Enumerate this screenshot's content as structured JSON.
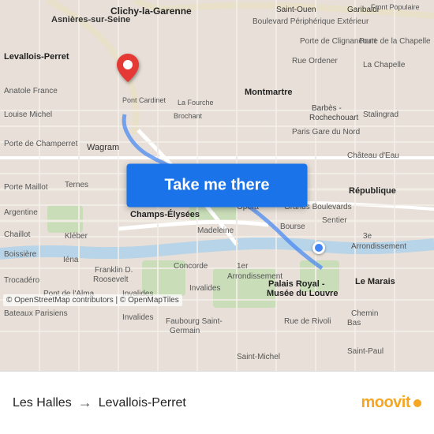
{
  "map": {
    "attribution": "© OpenStreetMap contributors | © OpenMapTiles"
  },
  "button": {
    "label": "Take me there"
  },
  "route": {
    "origin": "Les Halles",
    "destination": "Levallois-Perret",
    "arrow": "→"
  },
  "branding": {
    "name": "moovit"
  },
  "labels": {
    "clichy": "Clichy-la-Garenne",
    "levallois": "Levallois-Perret",
    "boulevard_ext": "Boulevard Périphérique Extérieur",
    "montmartre": "Montmartre",
    "champs_elysees": "Champs-Élysées",
    "opera": "Opéra",
    "les_halles": "1er Arrondissement",
    "asnieres": "Asnières-sur-Seine",
    "saint_ouen": "Saint-Ouen",
    "rue_ordener": "Rue Ordener",
    "la_chapelle": "La Chapelle",
    "le_marais": "Le Marais",
    "invalides": "Invalides",
    "faubourg": "Faubourg Saint-Germain"
  },
  "colors": {
    "map_bg": "#e8e0d8",
    "road_major": "#ffffff",
    "road_minor": "#f5f0eb",
    "water": "#b8d4e8",
    "park": "#d4e8c8",
    "button_bg": "#1a73e8",
    "button_text": "#ffffff",
    "pin_color": "#e53935",
    "dest_dot": "#4285f4",
    "moovit_color": "#f5a623"
  }
}
